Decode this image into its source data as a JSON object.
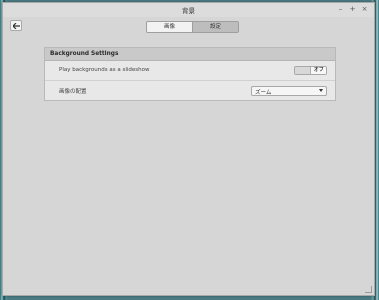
{
  "window": {
    "title": "背景",
    "controls": {
      "minimize": "–",
      "maximize": "+",
      "close": "×"
    }
  },
  "header": {
    "back_icon": "arrow-left-icon",
    "tabs": [
      {
        "label": "画像",
        "active": false
      },
      {
        "label": "設定",
        "active": true
      }
    ]
  },
  "settings": {
    "section_title": "Background Settings",
    "slideshow": {
      "label": "Play backgrounds as a slideshow",
      "state_label": "オフ",
      "enabled": false
    },
    "placement": {
      "label": "画像の配置",
      "selected": "ズーム"
    }
  }
}
